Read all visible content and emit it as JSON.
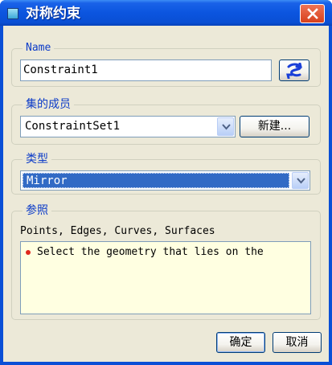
{
  "window": {
    "title": "对称约束"
  },
  "name_group": {
    "legend": "Name",
    "value": "Constraint1"
  },
  "set_group": {
    "legend": "集的成员",
    "selected": "ConstraintSet1",
    "new_button": "新建..."
  },
  "type_group": {
    "legend": "类型",
    "selected": "Mirror"
  },
  "refs_group": {
    "legend": "参照",
    "hint": "Points, Edges, Curves, Surfaces",
    "message": "Select the geometry that lies on the"
  },
  "footer": {
    "ok": "确定",
    "cancel": "取消"
  },
  "colors": {
    "title_bar": "#0a4fd6",
    "legend_text": "#0d3cc8",
    "selection": "#316ac5",
    "message_bg": "#ffffe1",
    "bullet": "#e0281c"
  }
}
